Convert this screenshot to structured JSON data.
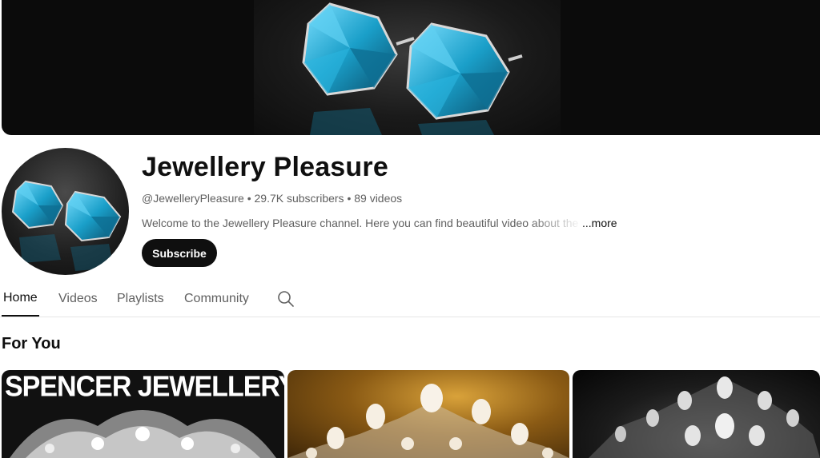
{
  "channel": {
    "name": "Jewellery Pleasure",
    "meta": "@JewelleryPleasure • 29.7K subscribers • 89 videos",
    "description": "Welcome to the Jewellery Pleasure channel. Here you can find beautiful video about the most",
    "more_label": "...more",
    "subscribe_label": "Subscribe"
  },
  "tabs": [
    {
      "label": "Home",
      "active": true
    },
    {
      "label": "Videos"
    },
    {
      "label": "Playlists"
    },
    {
      "label": "Community"
    }
  ],
  "section": {
    "title": "For You"
  },
  "videos": [
    {
      "thumbnail_text": "SPENCER JEWELLERY"
    },
    {
      "thumbnail_text": ""
    },
    {
      "thumbnail_text": ""
    }
  ],
  "icons": {
    "search": "search-icon"
  },
  "colors": {
    "text_primary": "#0f0f0f",
    "text_secondary": "#606060",
    "subscribe_bg": "#0f0f0f",
    "divider": "#e5e5e5"
  }
}
